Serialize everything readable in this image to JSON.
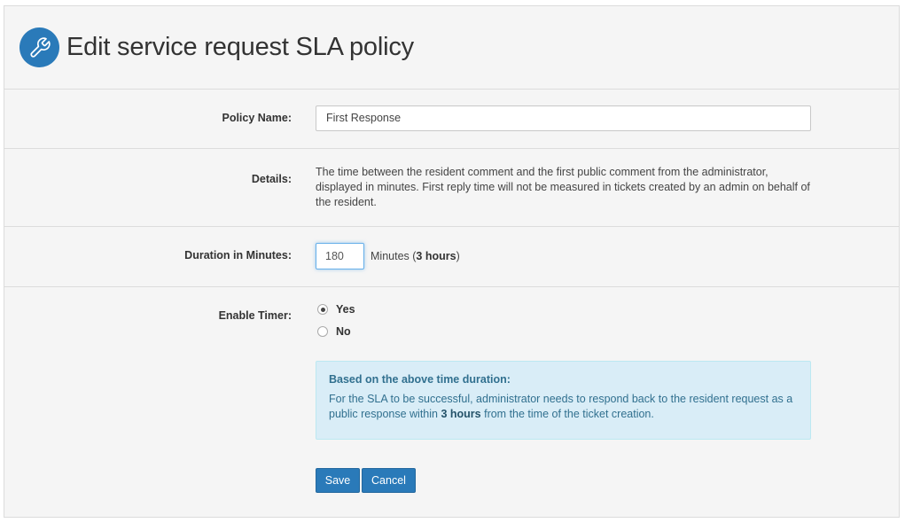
{
  "header": {
    "title": "Edit service request SLA policy",
    "icon": "wrench-icon",
    "icon_bg": "#2a7ab9"
  },
  "form": {
    "policy_name": {
      "label": "Policy Name:",
      "value": "First Response"
    },
    "details": {
      "label": "Details:",
      "text": "The time between the resident comment and the first public comment from the administrator, displayed in minutes. First reply time will not be measured in tickets created by an admin on behalf of the resident."
    },
    "duration": {
      "label": "Duration in Minutes:",
      "value": "180",
      "suffix_prefix": "Minutes (",
      "suffix_bold": "3 hours",
      "suffix_end": ")"
    },
    "timer": {
      "label": "Enable Timer:",
      "options": [
        {
          "label": "Yes",
          "checked": true
        },
        {
          "label": "No",
          "checked": false
        }
      ]
    },
    "info": {
      "title": "Based on the above time duration:",
      "text_before": "For the SLA to be successful, administrator needs to respond back to the resident request as a public response within ",
      "text_bold": "3 hours",
      "text_after": " from the time of the ticket creation."
    },
    "buttons": {
      "save": "Save",
      "cancel": "Cancel"
    }
  },
  "colors": {
    "primary": "#2a7ab9",
    "info_bg": "#d9edf7",
    "info_text": "#31708f"
  }
}
